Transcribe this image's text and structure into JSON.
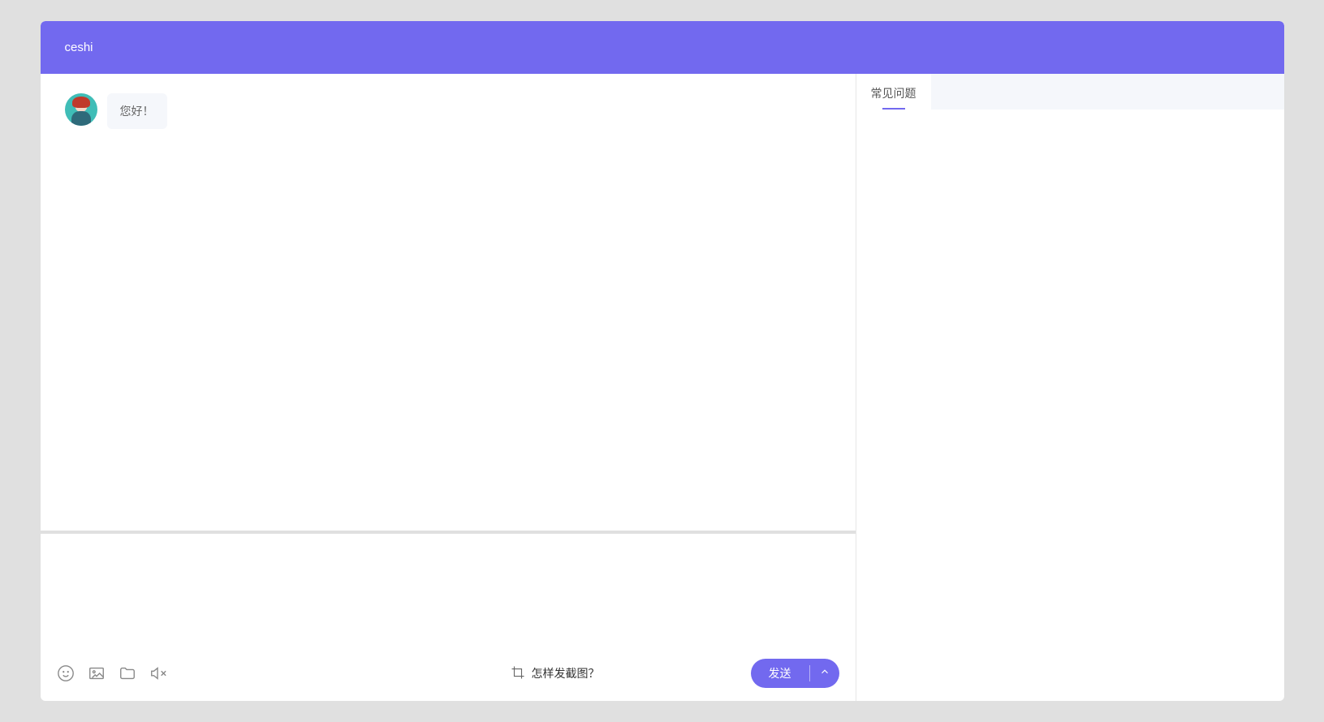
{
  "header": {
    "title": "ceshi"
  },
  "messages": [
    {
      "from": "agent",
      "text": "您好！"
    }
  ],
  "toolbar": {
    "crop_hint": "怎样发截图？",
    "send_label": "发送"
  },
  "sidebar": {
    "tabs": [
      {
        "label": "常见问题",
        "active": true
      }
    ]
  },
  "icons": {
    "emoji": "emoji-icon",
    "image": "image-icon",
    "folder": "folder-icon",
    "mute": "mute-icon",
    "crop": "crop-icon",
    "chevron_up": "chevron-up-icon"
  }
}
